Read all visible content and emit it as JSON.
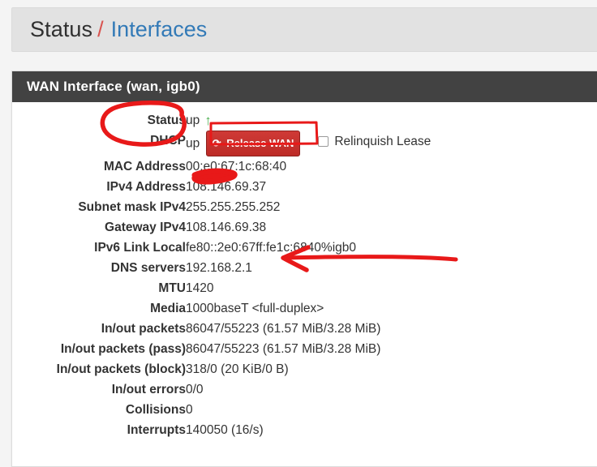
{
  "breadcrumb": {
    "root": "Status",
    "separator": "/",
    "current": "Interfaces"
  },
  "panel": {
    "title": "WAN Interface (wan, igb0)"
  },
  "rows": [
    {
      "label": "Status",
      "value": "up",
      "icon": "arrow-up-icon"
    },
    {
      "label": "DHCP",
      "value": "up"
    },
    {
      "label": "MAC Address",
      "value": "00:e0:67:1c:68:40"
    },
    {
      "label": "IPv4 Address",
      "value": "108.146.69.37"
    },
    {
      "label": "Subnet mask IPv4",
      "value": "255.255.255.252"
    },
    {
      "label": "Gateway IPv4",
      "value": "108.146.69.38"
    },
    {
      "label": "IPv6 Link Local",
      "value": "fe80::2e0:67ff:fe1c:6840%igb0"
    },
    {
      "label": "DNS servers",
      "value": "192.168.2.1"
    },
    {
      "label": "MTU",
      "value": "1420"
    },
    {
      "label": "Media",
      "value": "1000baseT <full-duplex>"
    },
    {
      "label": "In/out packets",
      "value": "86047/55223 (61.57 MiB/3.28 MiB)"
    },
    {
      "label": "In/out packets (pass)",
      "value": "86047/55223 (61.57 MiB/3.28 MiB)"
    },
    {
      "label": "In/out packets (block)",
      "value": "318/0 (20 KiB/0 B)"
    },
    {
      "label": "In/out errors",
      "value": "0/0"
    },
    {
      "label": "Collisions",
      "value": "0"
    },
    {
      "label": "Interrupts",
      "value": "140050 (16/s)"
    }
  ],
  "dhcp_controls": {
    "release_button_label": "Release WAN",
    "release_button_icon": "sync-refresh-icon",
    "relinquish_label": "Relinquish Lease",
    "relinquish_checked": false
  },
  "annotations": {
    "circle_target": "DHCP",
    "rect_target": "Release WAN",
    "scribble_target": "IPv4 Address",
    "arrow_target": "DNS servers",
    "ink_color": "#e81919"
  },
  "colors": {
    "page_background": "#f4f4f4",
    "breadcrumb_background": "#e2e2e2",
    "panel_heading_background": "#424242",
    "link": "#337ab7",
    "separator_red": "#d9534f",
    "button_red": "#c9302c",
    "status_up_green": "#4caf50",
    "annotation_red": "#e81919"
  }
}
